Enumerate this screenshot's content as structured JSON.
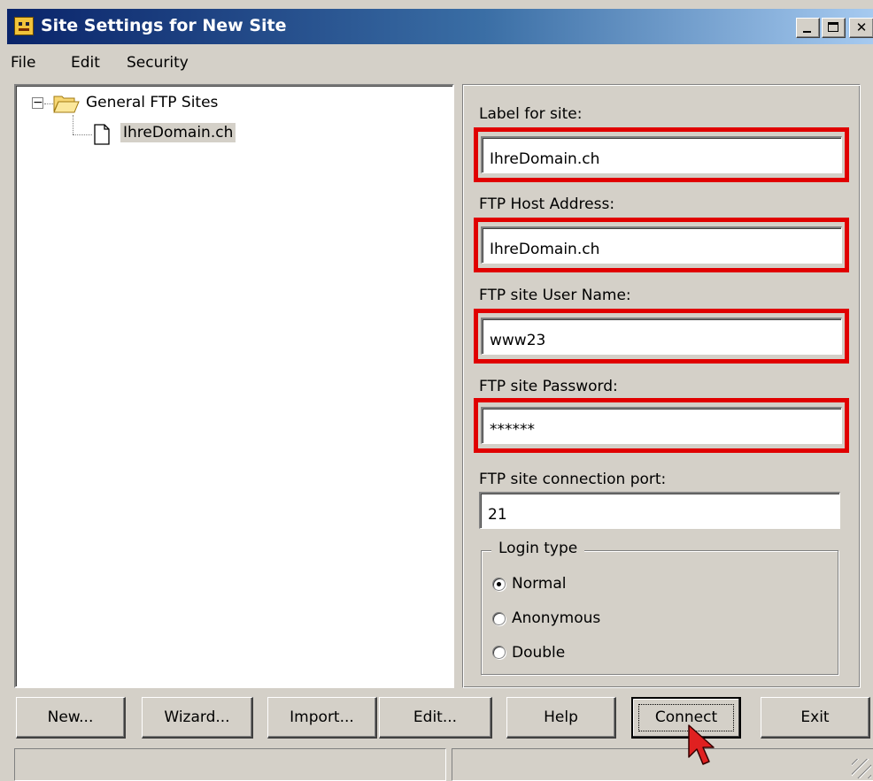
{
  "window": {
    "title": "Site Settings for New Site"
  },
  "menu": {
    "items": [
      "File",
      "Edit",
      "Security"
    ]
  },
  "tree": {
    "root_label": "General FTP Sites",
    "root_expander": "−",
    "child_label": "IhreDomain.ch"
  },
  "form": {
    "label_for_site": {
      "label": "Label for site:",
      "value": "IhreDomain.ch"
    },
    "host_address": {
      "label": "FTP Host Address:",
      "value": "IhreDomain.ch"
    },
    "user_name": {
      "label": "FTP site User Name:",
      "value": "www23"
    },
    "password": {
      "label": "FTP site Password:",
      "value": "******"
    },
    "port": {
      "label": "FTP site connection port:",
      "value": "21"
    }
  },
  "login_type": {
    "legend": "Login type",
    "options": [
      {
        "label": "Normal",
        "checked": true
      },
      {
        "label": "Anonymous",
        "checked": false
      },
      {
        "label": "Double",
        "checked": false
      }
    ]
  },
  "buttons": {
    "new": "New...",
    "wizard": "Wizard...",
    "import": "Import...",
    "edit": "Edit...",
    "help": "Help",
    "connect": "Connect",
    "exit": "Exit"
  },
  "colors": {
    "highlight_border": "#e00000",
    "titlebar_start": "#0a246a",
    "titlebar_end": "#a6caf0"
  },
  "icons": {
    "app": "ws-ftp-smiley-icon",
    "folder": "folder-open-icon",
    "file": "document-icon",
    "cursor": "arrow-cursor-icon"
  }
}
